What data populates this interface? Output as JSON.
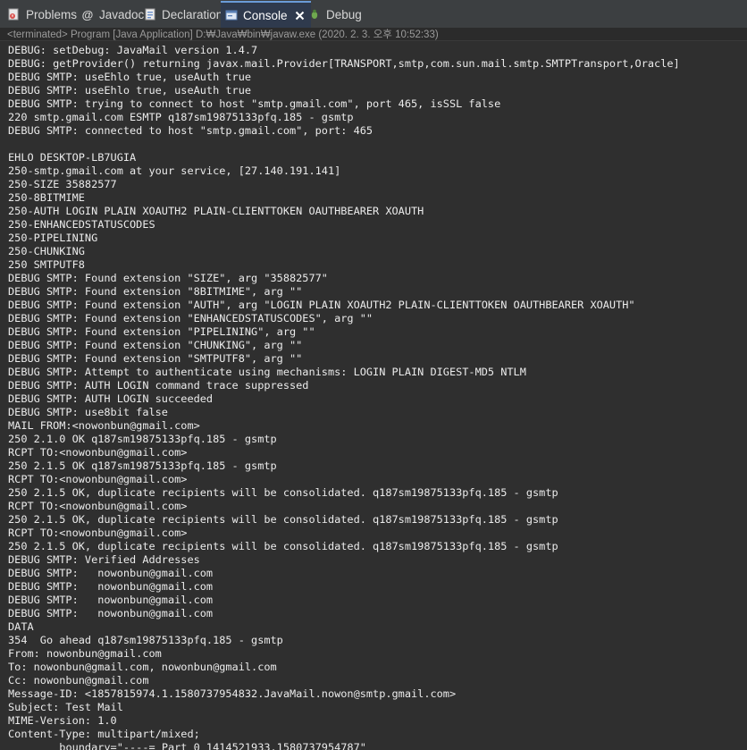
{
  "tabs": [
    {
      "label": "Problems",
      "icon": "problems-icon"
    },
    {
      "label": "Javadoc",
      "icon": "javadoc-icon"
    },
    {
      "label": "Declaration",
      "icon": "declaration-icon"
    },
    {
      "label": "Console",
      "icon": "console-icon",
      "active": true
    },
    {
      "label": "Debug",
      "icon": "debug-icon"
    }
  ],
  "status": "<terminated> Program [Java Application] D:₩Java₩bin₩javaw.exe (2020. 2. 3. 오후 10:52:33)",
  "console": {
    "lines": [
      "DEBUG: setDebug: JavaMail version 1.4.7",
      "DEBUG: getProvider() returning javax.mail.Provider[TRANSPORT,smtp,com.sun.mail.smtp.SMTPTransport,Oracle]",
      "DEBUG SMTP: useEhlo true, useAuth true",
      "DEBUG SMTP: useEhlo true, useAuth true",
      "DEBUG SMTP: trying to connect to host \"smtp.gmail.com\", port 465, isSSL false",
      "220 smtp.gmail.com ESMTP q187sm19875133pfq.185 - gsmtp",
      "DEBUG SMTP: connected to host \"smtp.gmail.com\", port: 465",
      "",
      "EHLO DESKTOP-LB7UGIA",
      "250-smtp.gmail.com at your service, [27.140.191.141]",
      "250-SIZE 35882577",
      "250-8BITMIME",
      "250-AUTH LOGIN PLAIN XOAUTH2 PLAIN-CLIENTTOKEN OAUTHBEARER XOAUTH",
      "250-ENHANCEDSTATUSCODES",
      "250-PIPELINING",
      "250-CHUNKING",
      "250 SMTPUTF8",
      "DEBUG SMTP: Found extension \"SIZE\", arg \"35882577\"",
      "DEBUG SMTP: Found extension \"8BITMIME\", arg \"\"",
      "DEBUG SMTP: Found extension \"AUTH\", arg \"LOGIN PLAIN XOAUTH2 PLAIN-CLIENTTOKEN OAUTHBEARER XOAUTH\"",
      "DEBUG SMTP: Found extension \"ENHANCEDSTATUSCODES\", arg \"\"",
      "DEBUG SMTP: Found extension \"PIPELINING\", arg \"\"",
      "DEBUG SMTP: Found extension \"CHUNKING\", arg \"\"",
      "DEBUG SMTP: Found extension \"SMTPUTF8\", arg \"\"",
      "DEBUG SMTP: Attempt to authenticate using mechanisms: LOGIN PLAIN DIGEST-MD5 NTLM",
      "DEBUG SMTP: AUTH LOGIN command trace suppressed",
      "DEBUG SMTP: AUTH LOGIN succeeded",
      "DEBUG SMTP: use8bit false",
      "MAIL FROM:<nowonbun@gmail.com>",
      "250 2.1.0 OK q187sm19875133pfq.185 - gsmtp",
      "RCPT TO:<nowonbun@gmail.com>",
      "250 2.1.5 OK q187sm19875133pfq.185 - gsmtp",
      "RCPT TO:<nowonbun@gmail.com>",
      "250 2.1.5 OK, duplicate recipients will be consolidated. q187sm19875133pfq.185 - gsmtp",
      "RCPT TO:<nowonbun@gmail.com>",
      "250 2.1.5 OK, duplicate recipients will be consolidated. q187sm19875133pfq.185 - gsmtp",
      "RCPT TO:<nowonbun@gmail.com>",
      "250 2.1.5 OK, duplicate recipients will be consolidated. q187sm19875133pfq.185 - gsmtp",
      "DEBUG SMTP: Verified Addresses",
      "DEBUG SMTP:   nowonbun@gmail.com",
      "DEBUG SMTP:   nowonbun@gmail.com",
      "DEBUG SMTP:   nowonbun@gmail.com",
      "DEBUG SMTP:   nowonbun@gmail.com",
      "DATA",
      "354  Go ahead q187sm19875133pfq.185 - gsmtp",
      "From: nowonbun@gmail.com",
      "To: nowonbun@gmail.com, nowonbun@gmail.com",
      "Cc: nowonbun@gmail.com",
      "Message-ID: <1857815974.1.1580737954832.JavaMail.nowon@smtp.gmail.com>",
      "Subject: Test Mail",
      "MIME-Version: 1.0",
      "Content-Type: multipart/mixed;",
      "\tboundary=\"----=_Part_0_1414521933.1580737954787\""
    ]
  },
  "colors": {
    "background": "#2f2f2f",
    "text": "#ebebeb",
    "tab_active_border": "#6a9bd7"
  }
}
